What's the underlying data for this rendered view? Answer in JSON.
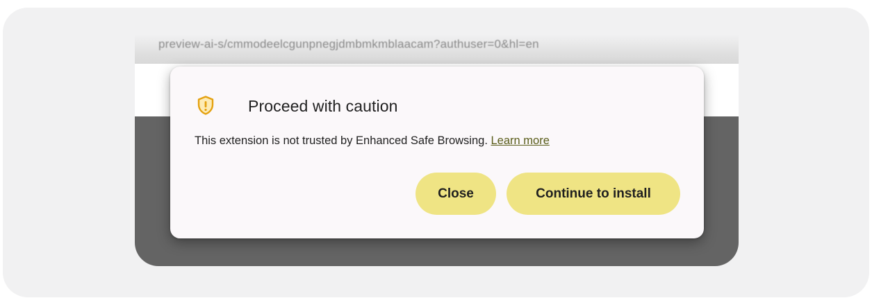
{
  "browser": {
    "url_fragment": "preview-ai-s/cmmodeelcgunpnegjdmbmkmblaacam?authuser=0&hl=en"
  },
  "dialog": {
    "title": "Proceed with caution",
    "message": "This extension is not trusted by Enhanced Safe Browsing.",
    "learn_more": "Learn more",
    "icon": "shield-warning-icon",
    "close_label": "Close",
    "continue_label": "Continue to install"
  },
  "colors": {
    "button_bg": "#efe484",
    "icon_accent": "#e4a10f",
    "dialog_bg": "#fbf8fa",
    "page_dark": "#646464"
  }
}
